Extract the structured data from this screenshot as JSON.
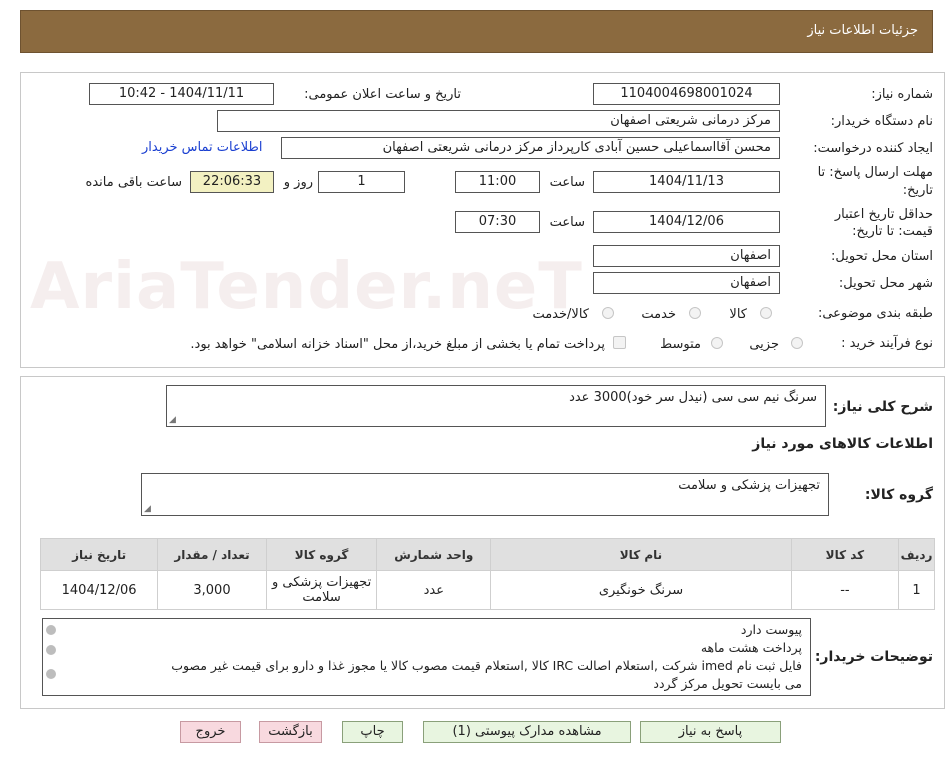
{
  "header": {
    "title": "جزئیات اطلاعات نیاز"
  },
  "watermark": "AriaTender.neT",
  "info": {
    "need_number_label": "شماره نیاز:",
    "need_number": "1104004698001024",
    "announce_label": "تاریخ و ساعت اعلان عمومی:",
    "announce_value": "1404/11/11 - 10:42",
    "buyer_label": "نام دستگاه خریدار:",
    "buyer_value": "مرکز درمانی شریعتی اصفهان",
    "requester_label": "ایجاد کننده درخواست:",
    "requester_value": "محسن آقااسماعیلی حسین آبادی کارپرداز مرکز درمانی شریعتی اصفهان",
    "contact_link": "اطلاعات تماس خریدار",
    "deadline_label_1": "مهلت ارسال پاسخ: تا",
    "deadline_label_2": "تاریخ:",
    "deadline_date": "1404/11/13",
    "time_word": "ساعت",
    "deadline_time": "11:00",
    "days_value": "1",
    "days_word": "روز و",
    "remaining_time": "22:06:33",
    "remaining_word": "ساعت باقی مانده",
    "validity_label_1": "حداقل تاریخ اعتبار",
    "validity_label_2": "قیمت: تا تاریخ:",
    "validity_date": "1404/12/06",
    "validity_time": "07:30",
    "province_label": "استان محل تحویل:",
    "province_value": "اصفهان",
    "city_label": "شهر محل تحویل:",
    "city_value": "اصفهان",
    "category_label": "طبقه بندی موضوعی:",
    "category_options": [
      "کالا",
      "خدمت",
      "کالا/خدمت"
    ],
    "process_label": "نوع فرآیند خرید :",
    "process_options": [
      "جزیی",
      "متوسط"
    ],
    "treasury_note": "پرداخت تمام یا بخشی از مبلغ خرید،از محل \"اسناد خزانه اسلامی\" خواهد بود."
  },
  "summary": {
    "label": "شرح کلی نیاز:",
    "value": "سرنگ نیم سی سی (نیدل سر خود)3000 عدد",
    "goods_info_title": "اطلاعات کالاهای مورد نیاز",
    "group_label": "گروه کالا:",
    "group_value": "تجهیزات پزشکی و سلامت"
  },
  "table": {
    "headers": [
      "ردیف",
      "کد کالا",
      "نام کالا",
      "واحد شمارش",
      "گروه کالا",
      "تعداد / مقدار",
      "تاریخ نیاز"
    ],
    "rows": [
      [
        "1",
        "--",
        "سرنگ خونگیری",
        "عدد",
        "تجهیزات پزشکی و سلامت",
        "3,000",
        "1404/12/06"
      ]
    ]
  },
  "notes": {
    "label": "توضیحات خریدار:",
    "lines": [
      "پیوست دارد",
      "پرداخت هشت ماهه",
      "فایل ثبت نام imed شرکت ,استعلام اصالت IRC کالا ,استعلام قیمت مصوب کالا یا مجوز غذا و دارو برای قیمت غیر مصوب",
      "می بایست تحویل مرکز گردد"
    ]
  },
  "buttons": {
    "reply": "پاسخ به نیاز",
    "attachments": "مشاهده مدارک پیوستی (1)",
    "print": "چاپ",
    "back": "بازگشت",
    "exit": "خروج"
  }
}
